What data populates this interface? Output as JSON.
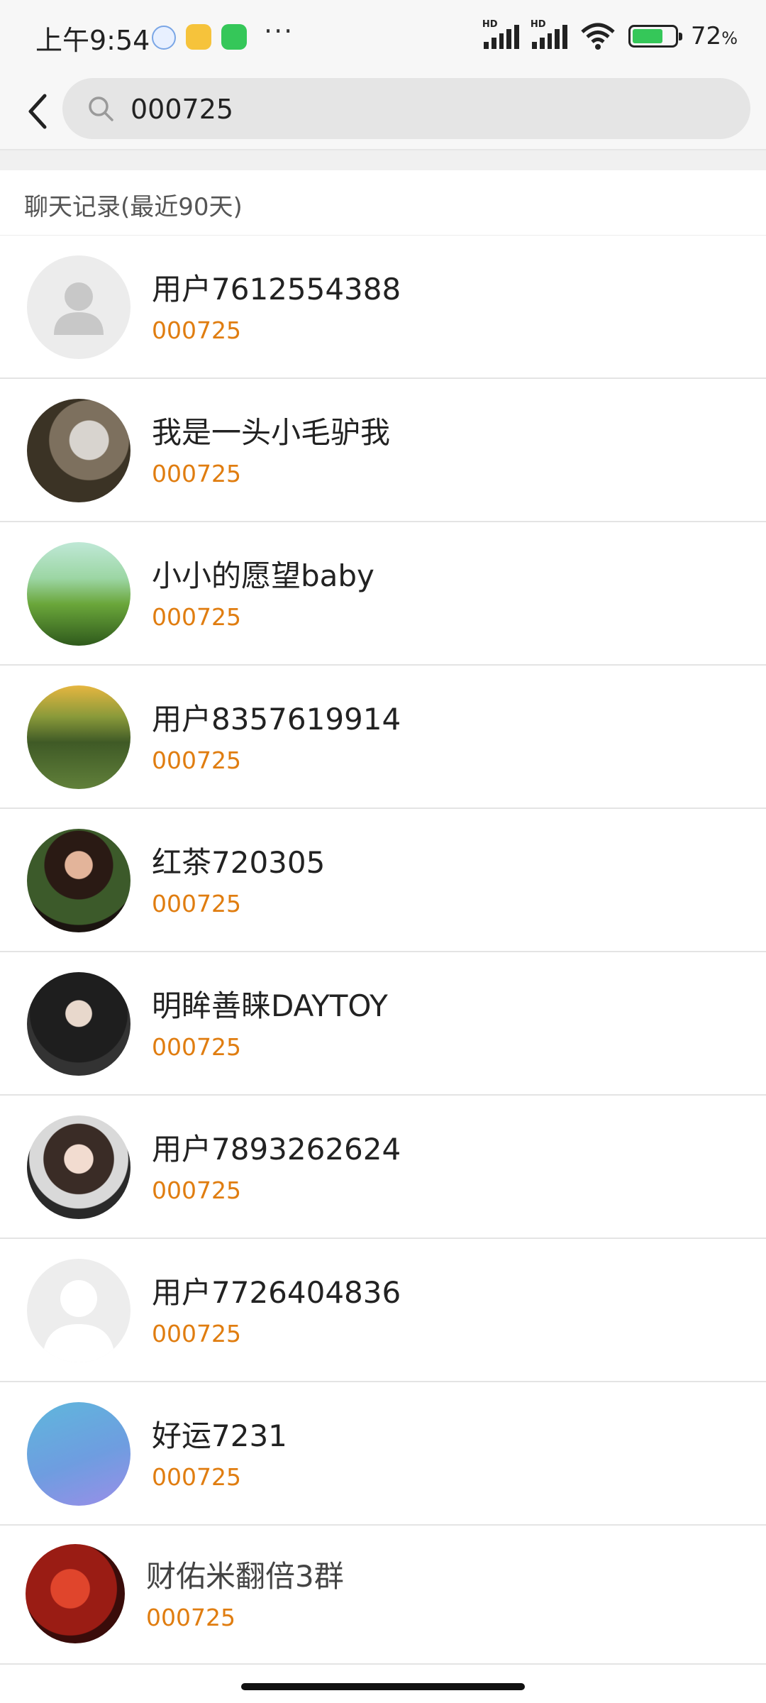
{
  "status_bar": {
    "time": "上午9:54",
    "signal_label": "HD",
    "battery_value": "72",
    "battery_unit": "%",
    "icons": [
      "baidu-app-icon",
      "weibo-app-icon",
      "wechat-app-icon",
      "more-dots-icon",
      "signal-icon",
      "wifi-icon",
      "battery-icon"
    ]
  },
  "search": {
    "query": "000725",
    "icon": "search-icon"
  },
  "section": {
    "label": "聊天记录(最近90天)"
  },
  "results": [
    {
      "name": "用户7612554388",
      "snippet": "000725",
      "avatar": "default-user"
    },
    {
      "name": "我是一头小毛驴我",
      "snippet": "000725",
      "avatar": "scooter-photo"
    },
    {
      "name": "小小的愿望baby",
      "snippet": "000725",
      "avatar": "green-landscape"
    },
    {
      "name": "用户8357619914",
      "snippet": "000725",
      "avatar": "forest-hill"
    },
    {
      "name": "红茶720305",
      "snippet": "000725",
      "avatar": "woman-portrait"
    },
    {
      "name": "明眸善睐DAYTOY",
      "snippet": "000725",
      "avatar": "man-portrait"
    },
    {
      "name": "用户7893262624",
      "snippet": "000725",
      "avatar": "girl-portrait"
    },
    {
      "name": "用户7726404836",
      "snippet": "000725",
      "avatar": "default-silhouette"
    },
    {
      "name": "好运7231",
      "snippet": "000725",
      "avatar": "blue-gradient"
    },
    {
      "name": "财佑米翻倍3群",
      "snippet": "000725",
      "avatar": "red-bull"
    }
  ],
  "colors": {
    "snippet": "#e07d10",
    "search_bg": "#e5e5e5",
    "status_bg": "#f7f7f7"
  }
}
